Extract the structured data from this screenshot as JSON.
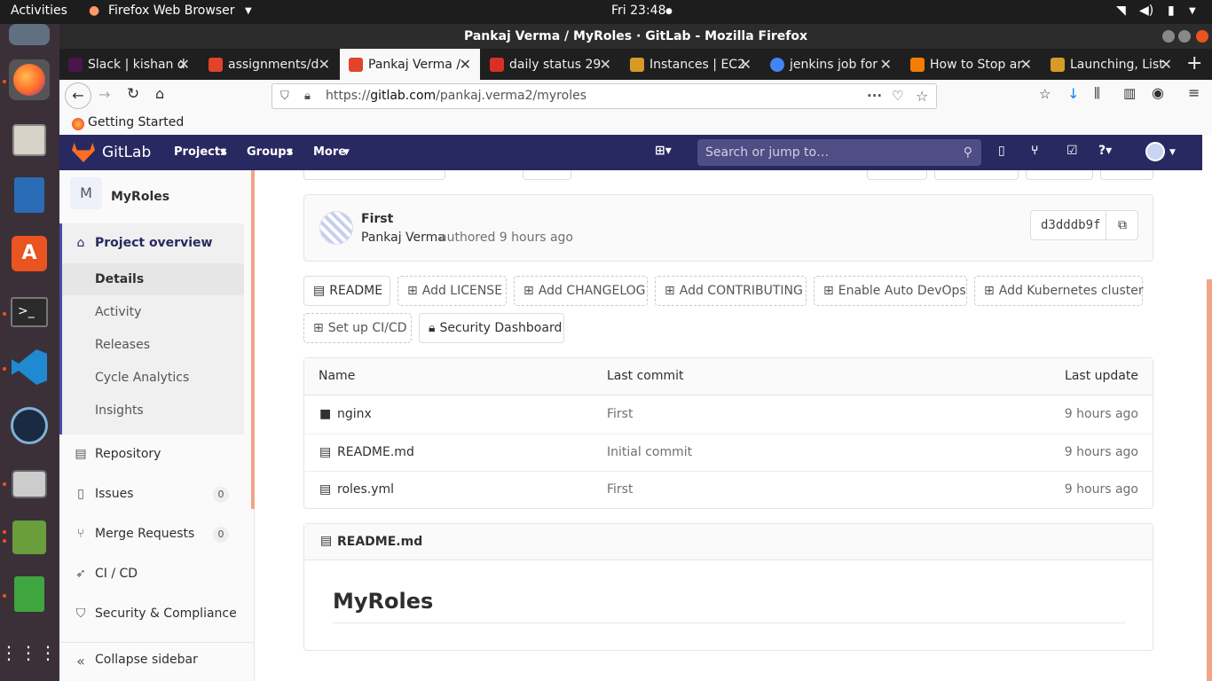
{
  "system": {
    "activities": "Activities",
    "app_name": "Firefox Web Browser",
    "clock": "Fri 23:48"
  },
  "window": {
    "title": "Pankaj Verma / MyRoles · GitLab - Mozilla Firefox"
  },
  "tabs": [
    {
      "label": "Slack | kishan d",
      "color": "#4a154b"
    },
    {
      "label": "assignments/d",
      "color": "#e24329"
    },
    {
      "label": "Pankaj Verma /",
      "color": "#e24329"
    },
    {
      "label": "daily status 29",
      "color": "#d93025"
    },
    {
      "label": "Instances | EC2",
      "color": "#d79a27"
    },
    {
      "label": "jenkins job for",
      "color": "#4285f4"
    },
    {
      "label": "How to Stop ar",
      "color": "#f57d00"
    },
    {
      "label": "Launching, List",
      "color": "#d79a27"
    }
  ],
  "address_bar": {
    "prefix": "https://",
    "domain": "gitlab.com",
    "path": "/pankaj.verma2/myroles"
  },
  "bookmarks": {
    "getting_started": "Getting Started"
  },
  "gitlab_header": {
    "brand": "GitLab",
    "projects": "Projects",
    "groups": "Groups",
    "more": "More",
    "search_placeholder": "Search or jump to…"
  },
  "sidebar": {
    "project_avatar": "M",
    "project_name": "MyRoles",
    "overview": "Project overview",
    "sub_items": [
      "Details",
      "Activity",
      "Releases",
      "Cycle Analytics",
      "Insights"
    ],
    "repository": "Repository",
    "issues": "Issues",
    "issues_count": "0",
    "merge_requests": "Merge Requests",
    "merge_requests_count": "0",
    "cicd": "CI / CD",
    "security": "Security & Compliance",
    "collapse": "Collapse sidebar"
  },
  "commit": {
    "title": "First",
    "author": "Pankaj Verma",
    "authored": "authored 9 hours ago",
    "sha": "d3dddb9f"
  },
  "quick_actions": {
    "readme": "README",
    "add_license": "Add LICENSE",
    "add_changelog": "Add CHANGELOG",
    "add_contributing": "Add CONTRIBUTING",
    "auto_devops": "Enable Auto DevOps",
    "kubernetes": "Add Kubernetes cluster",
    "cicd": "Set up CI/CD",
    "security_dashboard": "Security Dashboard"
  },
  "file_table": {
    "headers": {
      "name": "Name",
      "last_commit": "Last commit",
      "last_update": "Last update"
    },
    "rows": [
      {
        "name": "nginx",
        "commit": "First",
        "updated": "9 hours ago",
        "type": "folder"
      },
      {
        "name": "README.md",
        "commit": "Initial commit",
        "updated": "9 hours ago",
        "type": "file"
      },
      {
        "name": "roles.yml",
        "commit": "First",
        "updated": "9 hours ago",
        "type": "file"
      }
    ]
  },
  "readme": {
    "filename": "README.md",
    "heading": "MyRoles"
  }
}
